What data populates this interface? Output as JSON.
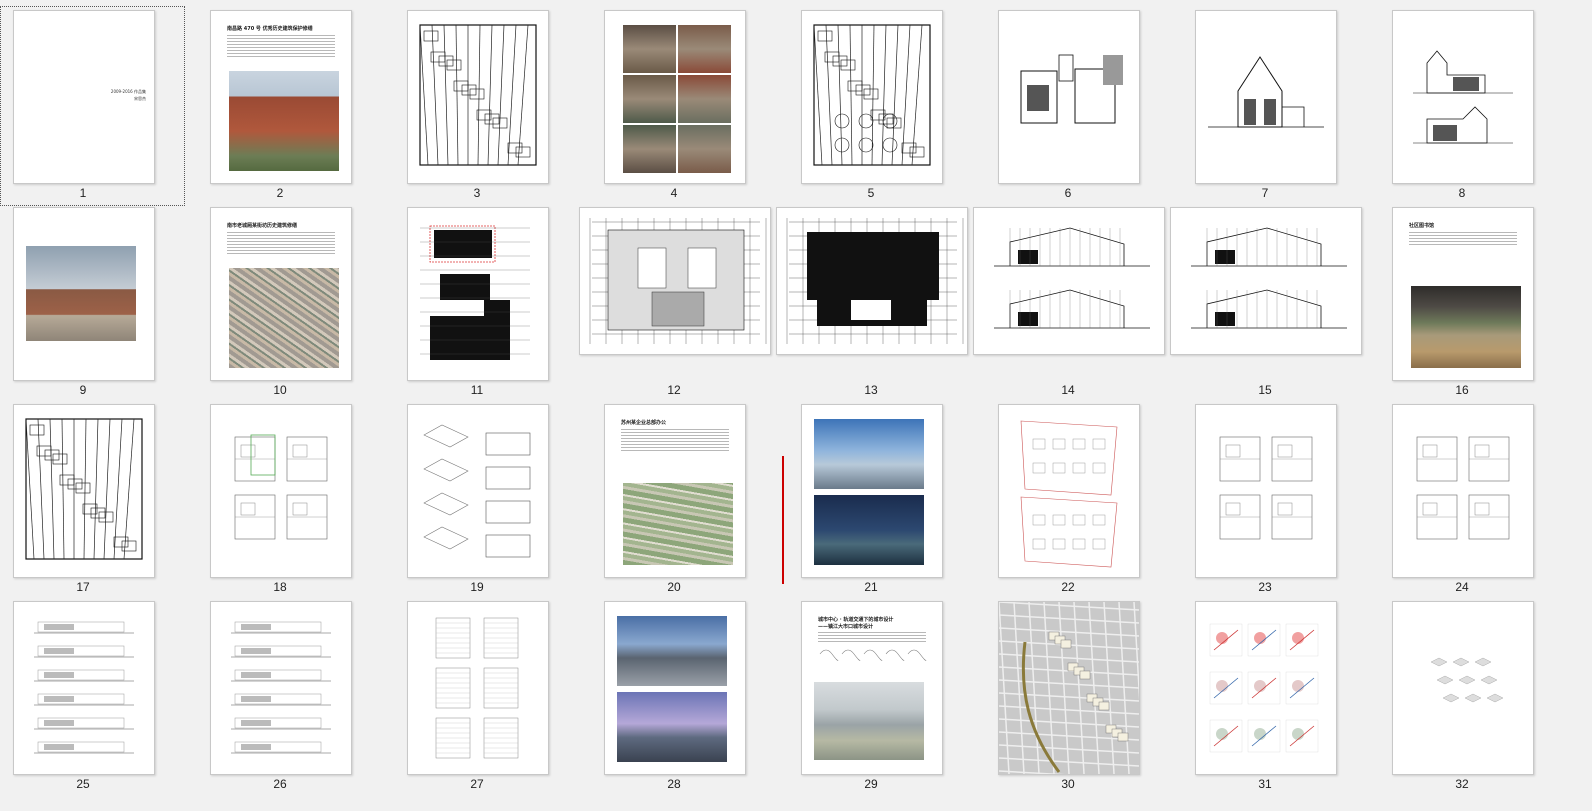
{
  "view": "slide-sorter",
  "slides": [
    {
      "number": "1",
      "kind": "title",
      "text_line1": "2009-2016 作品集",
      "text_line2": "宋思杰",
      "selected": true
    },
    {
      "number": "2",
      "kind": "text-photo",
      "heading": "南昌路 470 号 优秀历史建筑保护修缮",
      "photo": "brick-house"
    },
    {
      "number": "3",
      "kind": "site-plan"
    },
    {
      "number": "4",
      "kind": "photo-grid"
    },
    {
      "number": "5",
      "kind": "site-plan-round"
    },
    {
      "number": "6",
      "kind": "floor-plans"
    },
    {
      "number": "7",
      "kind": "section"
    },
    {
      "number": "8",
      "kind": "elevations"
    },
    {
      "number": "9",
      "kind": "photo",
      "photo": "brick-house-render"
    },
    {
      "number": "10",
      "kind": "text-photo",
      "heading": "南市老城厢某街坊历史建筑修缮",
      "photo": "aerial-city"
    },
    {
      "number": "11",
      "kind": "plan-black"
    },
    {
      "number": "12",
      "kind": "wide-plan-hatch"
    },
    {
      "number": "13",
      "kind": "wide-plan-black"
    },
    {
      "number": "14",
      "kind": "wide-sections"
    },
    {
      "number": "15",
      "kind": "wide-sections"
    },
    {
      "number": "16",
      "kind": "text-photo",
      "heading": "社区图书馆",
      "photo": "interior"
    },
    {
      "number": "17",
      "kind": "site-plan"
    },
    {
      "number": "18",
      "kind": "floor-plans-light"
    },
    {
      "number": "19",
      "kind": "diagrams"
    },
    {
      "number": "20",
      "kind": "text-photo",
      "heading": "苏州某企业总部办公",
      "photo": "aerial-green"
    },
    {
      "number": "21",
      "kind": "two-photos",
      "photo": "towers"
    },
    {
      "number": "22",
      "kind": "red-plans"
    },
    {
      "number": "23",
      "kind": "floor-plans-light"
    },
    {
      "number": "24",
      "kind": "floor-plans-light"
    },
    {
      "number": "25",
      "kind": "elevation-strips"
    },
    {
      "number": "26",
      "kind": "elevation-strips"
    },
    {
      "number": "27",
      "kind": "elevation-grid"
    },
    {
      "number": "28",
      "kind": "two-photos",
      "photo": "stadium"
    },
    {
      "number": "29",
      "kind": "text-photo",
      "heading": "城市中心 · 轨道交通下的城市设计",
      "subheading": "——镇江大市口城市设计",
      "photo": "city-model"
    },
    {
      "number": "30",
      "kind": "urban-map"
    },
    {
      "number": "31",
      "kind": "analysis-grid"
    },
    {
      "number": "32",
      "kind": "axonometric"
    }
  ],
  "colors": {
    "background": "#f1f1f1",
    "insert_marker": "#cc0000",
    "selection_border": "#555555"
  }
}
